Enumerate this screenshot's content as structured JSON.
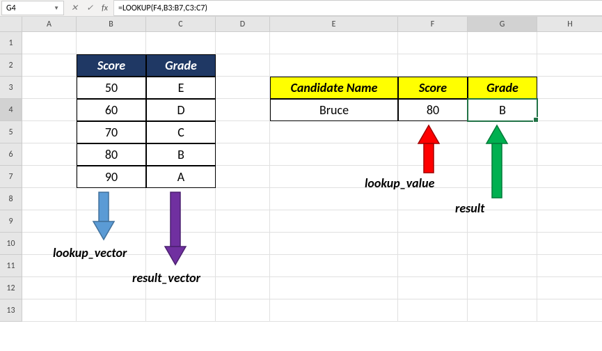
{
  "namebox": "G4",
  "formula": "=LOOKUP(F4,B3:B7,C3:C7)",
  "columns": [
    "A",
    "B",
    "C",
    "D",
    "E",
    "F",
    "G",
    "H"
  ],
  "rowcount": 13,
  "hdr": {
    "score": "Score",
    "grade": "Grade"
  },
  "table1": [
    {
      "score": "50",
      "grade": "E"
    },
    {
      "score": "60",
      "grade": "D"
    },
    {
      "score": "70",
      "grade": "C"
    },
    {
      "score": "80",
      "grade": "B"
    },
    {
      "score": "90",
      "grade": "A"
    }
  ],
  "hdr2": {
    "cand": "Candidate Name",
    "score": "Score",
    "grade": "Grade"
  },
  "row4": {
    "cand": "Bruce",
    "score": "80",
    "grade": "B"
  },
  "ann": {
    "lookup_vector": "lookup_vector",
    "result_vector": "result_vector",
    "lookup_value": "lookup_value",
    "result": "result"
  },
  "chart_data": {
    "type": "table",
    "lookup_table": {
      "columns": [
        "Score",
        "Grade"
      ],
      "rows": [
        [
          50,
          "E"
        ],
        [
          60,
          "D"
        ],
        [
          70,
          "C"
        ],
        [
          80,
          "B"
        ],
        [
          90,
          "A"
        ]
      ]
    },
    "query": {
      "Candidate Name": "Bruce",
      "Score": 80,
      "Grade": "B"
    },
    "formula": "=LOOKUP(F4,B3:B7,C3:C7)"
  }
}
